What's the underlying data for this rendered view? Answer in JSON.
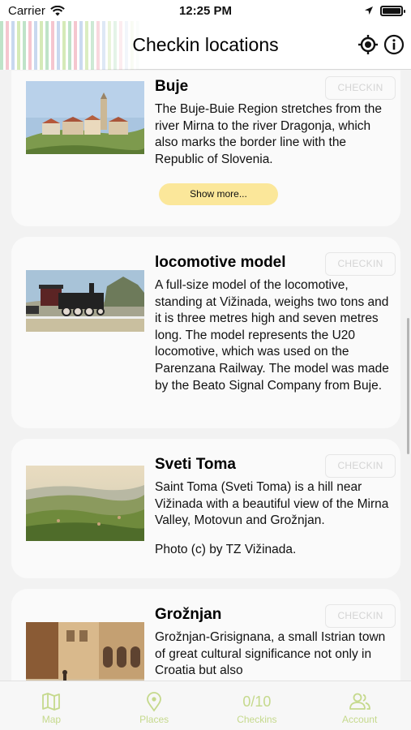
{
  "status_bar": {
    "carrier": "Carrier",
    "time": "12:25 PM"
  },
  "header": {
    "title": "Checkin locations",
    "icons": [
      "location-target-icon",
      "info-icon"
    ]
  },
  "locations": [
    {
      "title": "Buje",
      "description": "The Buje-Buie Region stretches from the river Mirna to the river Dragonja, which also marks the border line with the Republic of Slovenia.",
      "checkin_label": "CHECKIN",
      "show_more_label": "Show more..."
    },
    {
      "title": "locomotive model",
      "description": "A full-size model of the locomotive, standing at Vižinada, weighs two tons and it is three metres high and seven metres long. The model represents the U20 locomotive, which was used on the Parenzana Railway. The model was made by the Beato Signal Company from Buje.",
      "checkin_label": "CHECKIN"
    },
    {
      "title": "Sveti Toma",
      "description": "Saint Toma (Sveti Toma) is a hill near Vižinada with a beautiful view of the Mirna Valley, Motovun and Grožnjan.",
      "photo_credit": "Photo (c) by TZ Vižinada.",
      "checkin_label": "CHECKIN"
    },
    {
      "title": "Grožnjan",
      "description": "Grožnjan-Grisignana, a small Istrian town of great cultural significance not only in Croatia but also",
      "checkin_label": "CHECKIN"
    }
  ],
  "tabs": [
    {
      "label": "Map",
      "icon": "map-icon"
    },
    {
      "label": "Places",
      "icon": "places-pin-icon"
    },
    {
      "label": "Checkins",
      "count": "0/10"
    },
    {
      "label": "Account",
      "icon": "account-icon"
    }
  ],
  "colors": {
    "accent": "#c5d98c",
    "show_more_bg": "#fbe79a",
    "card_bg": "#fafafa"
  }
}
